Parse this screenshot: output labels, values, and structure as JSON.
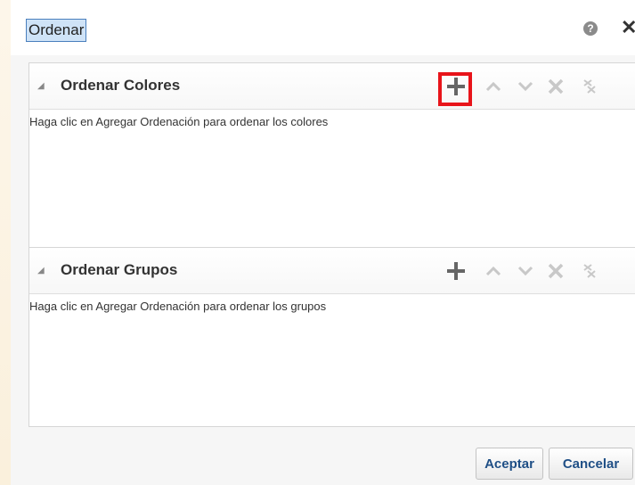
{
  "dialog": {
    "title": "Ordenar",
    "help_glyph": "?",
    "close_glyph": "✕"
  },
  "panels": [
    {
      "title": "Ordenar Colores",
      "hint": "Haga clic en Agregar Ordenación para ordenar los colores",
      "toolbar": [
        "add-icon",
        "move-up-icon",
        "move-down-icon",
        "delete-icon",
        "delete-all-icon"
      ],
      "highlighted_tool": "add-icon"
    },
    {
      "title": "Ordenar Grupos",
      "hint": "Haga clic en Agregar Ordenación para ordenar los grupos",
      "toolbar": [
        "add-icon",
        "move-up-icon",
        "move-down-icon",
        "delete-icon",
        "delete-all-icon"
      ]
    }
  ],
  "buttons": {
    "ok": "Aceptar",
    "cancel": "Cancelar"
  },
  "colors": {
    "highlight": "#e8141a",
    "active_icon": "#666666",
    "disabled_icon": "#c8c8c8",
    "button_text": "#1f4f86"
  }
}
